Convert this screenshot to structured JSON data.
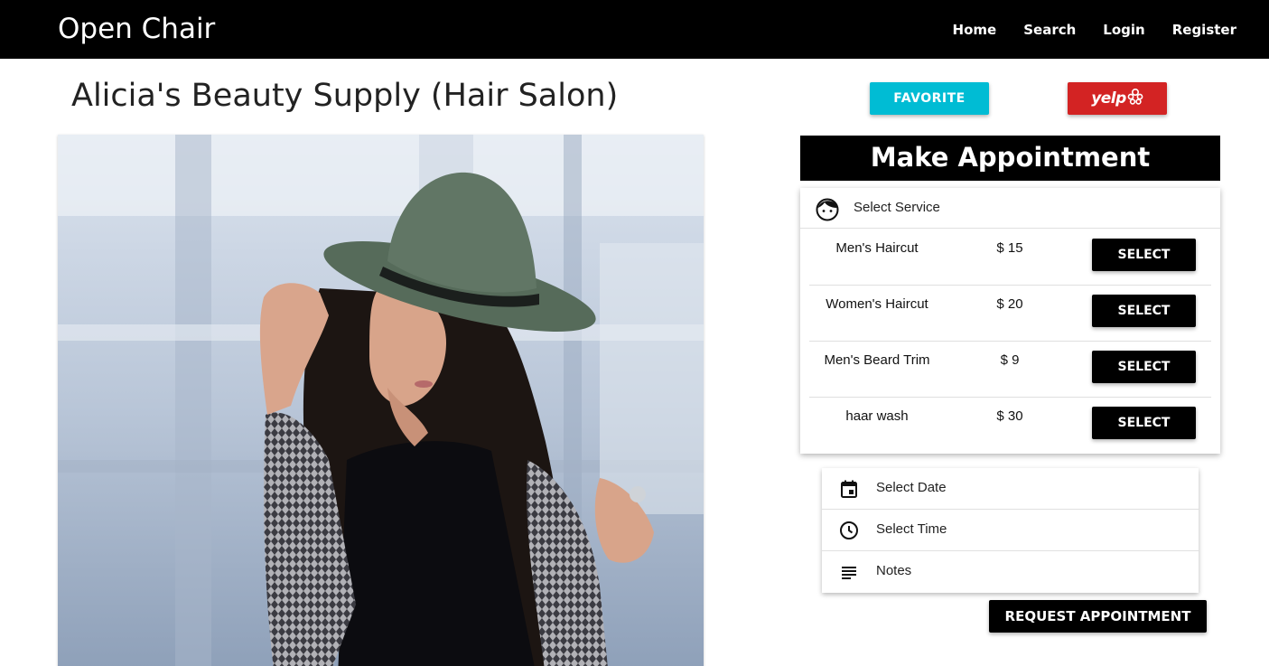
{
  "navbar": {
    "brand": "Open Chair",
    "links": [
      "Home",
      "Search",
      "Login",
      "Register"
    ]
  },
  "page": {
    "title": "Alicia's Beauty Supply (Hair Salon)",
    "favorite_label": "FAVORITE",
    "yelp_label": "yelp"
  },
  "appointment": {
    "header": "Make Appointment",
    "service_heading": "Select Service",
    "services": [
      {
        "name": "Men's Haircut",
        "price": "$ 15",
        "button": "SELECT"
      },
      {
        "name": "Women's Haircut",
        "price": "$ 20",
        "button": "SELECT"
      },
      {
        "name": "Men's Beard Trim",
        "price": "$ 9",
        "button": "SELECT"
      },
      {
        "name": "haar wash",
        "price": "$ 30",
        "button": "SELECT"
      }
    ],
    "date_label": "Select Date",
    "time_label": "Select Time",
    "notes_label": "Notes",
    "request_label": "REQUEST APPOINTMENT"
  },
  "icons": {
    "service": "face-icon",
    "date": "calendar-icon",
    "time": "clock-icon",
    "notes": "notes-icon",
    "yelp": "yelp-burst-icon"
  },
  "colors": {
    "navbar": "#000000",
    "favorite": "#00bcd4",
    "yelp": "#d32323",
    "buttons": "#000000"
  }
}
